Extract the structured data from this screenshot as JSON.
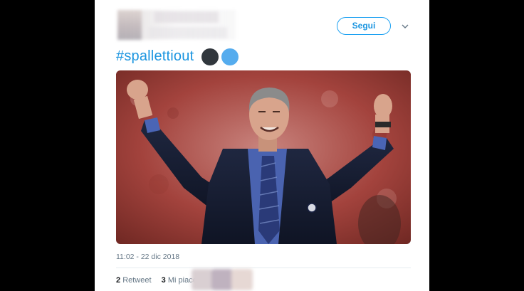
{
  "tweet": {
    "follow_label": "Segui",
    "hashtag": "#spallettiout",
    "emojis": [
      "black-circle",
      "blue-circle"
    ],
    "timestamp": "11:02 - 22 dic 2018",
    "retweet_count": "2",
    "retweet_label": "Retweet",
    "like_count": "3",
    "like_label": "Mi piace"
  },
  "colors": {
    "accent": "#1b95e0",
    "secondary_text": "#657786",
    "background": "#000000",
    "card": "#ffffff"
  },
  "icons": {
    "menu": "chevron-down-icon"
  }
}
